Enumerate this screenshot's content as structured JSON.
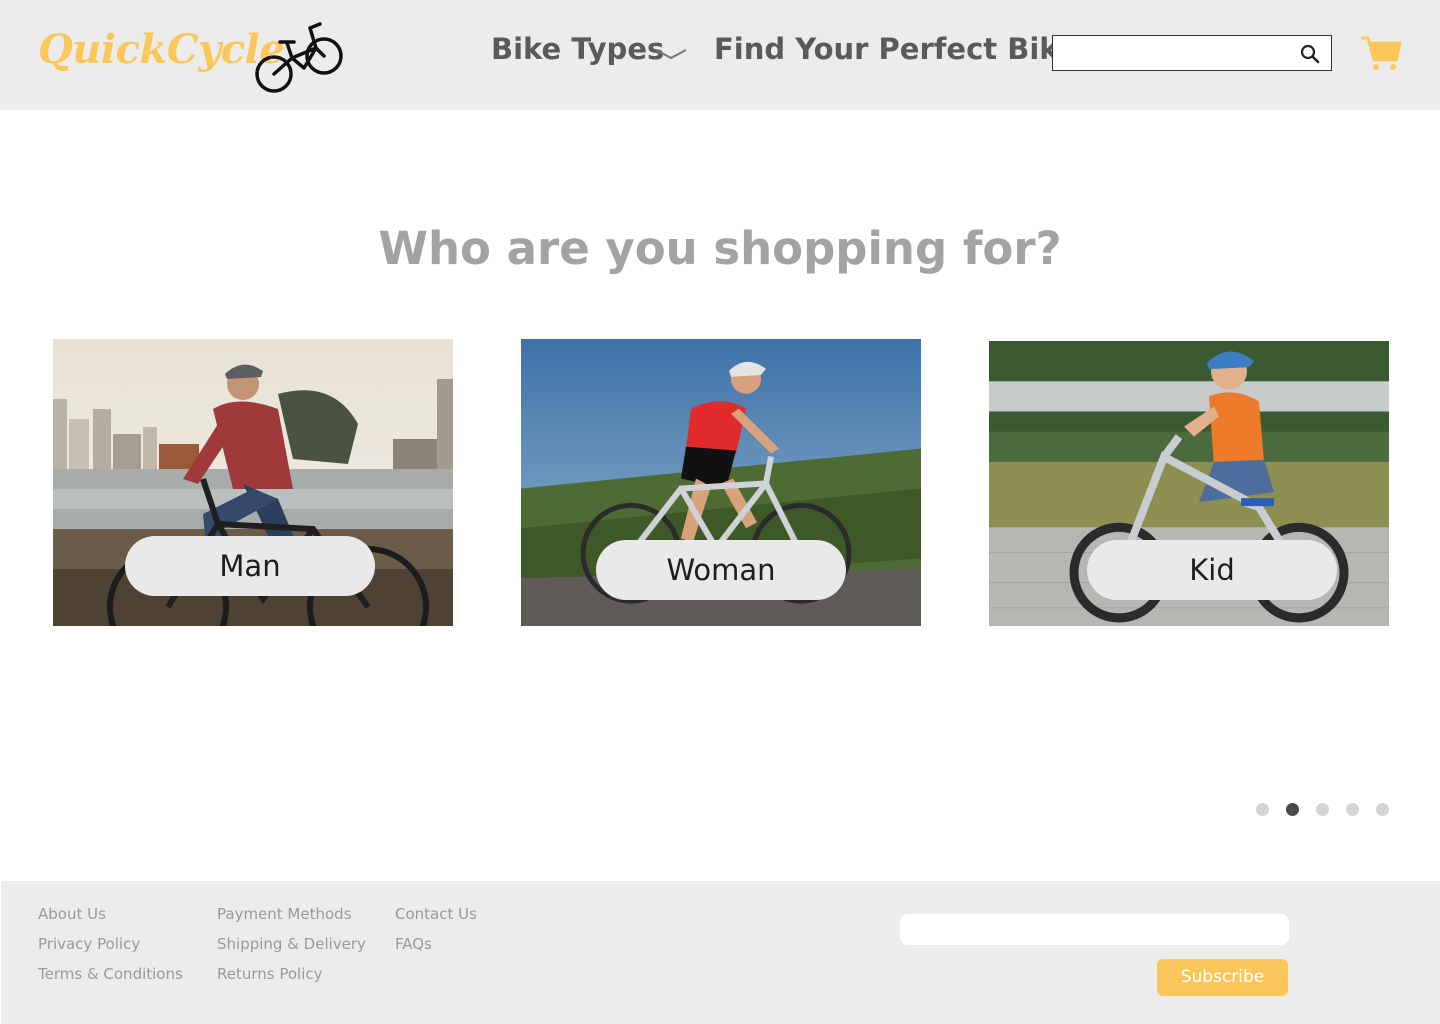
{
  "brand": {
    "name": "QuickCycle",
    "color": "#fbc75b",
    "logo_icon": "bicycle-icon"
  },
  "nav": {
    "bike_types": "Bike Types",
    "bike_types_icon": "chevron-down-icon",
    "find_bike": "Find Your Perfect Bike"
  },
  "search": {
    "placeholder": "",
    "value": "",
    "icon": "search-icon"
  },
  "cart": {
    "icon": "shopping-cart-icon",
    "color": "#fbc75b"
  },
  "main": {
    "headline": "Who are you shopping for?",
    "cards": [
      {
        "label": "Man",
        "image": "man cycling along riverside city skyline"
      },
      {
        "label": "Woman",
        "image": "woman on road bike on hillside"
      },
      {
        "label": "Kid",
        "image": "child on small bike with helmet"
      }
    ],
    "carousel": {
      "total": 5,
      "active_index": 1
    }
  },
  "footer": {
    "links_col1": [
      "About Us",
      "Privacy Policy",
      "Terms & Conditions"
    ],
    "links_col2": [
      "Payment Methods",
      "Shipping & Delivery",
      "Returns Policy"
    ],
    "links_col3": [
      "Contact Us",
      "FAQs"
    ],
    "subscribe": {
      "placeholder": "",
      "button_label": "Subscribe",
      "button_color": "#fbc75b"
    }
  }
}
